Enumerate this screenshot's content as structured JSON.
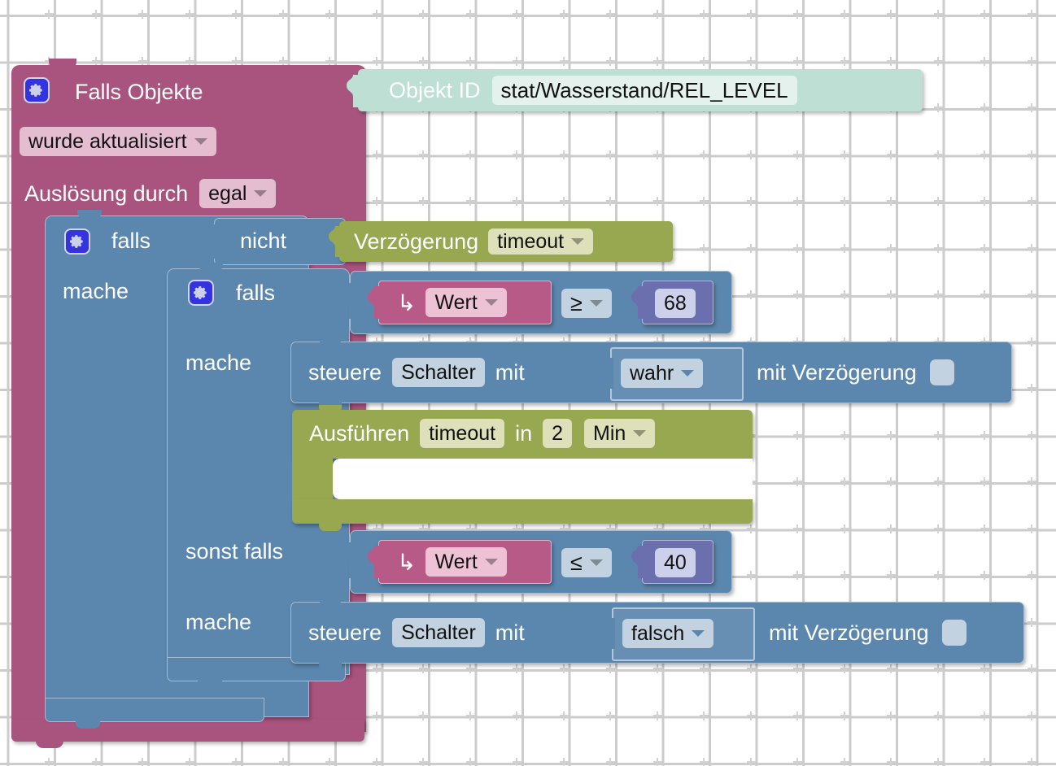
{
  "app": {
    "type": "blockly-visual-script",
    "language": "de"
  },
  "palette": {
    "trigger_block": "#a8547e",
    "logic_block": "#5b86ad",
    "timing_block": "#98a851",
    "object_id_block": "#bedfd3",
    "value_block": "#b85a87",
    "number_block": "#6b6fae",
    "mutator_icon": "#3333e0",
    "workspace_bg": "#ffffff",
    "grid_dot": "#d2d2d2"
  },
  "script": {
    "trigger": {
      "title": "Falls Objekte",
      "mutator_icon": "gear-icon",
      "object_id": {
        "label": "Objekt ID",
        "value": "stat/Wasserstand/REL_LEVEL"
      },
      "condition_dropdown": "wurde aktualisiert",
      "source_label": "Auslösung durch",
      "source_dropdown": "egal"
    },
    "outer_if": {
      "mutator_icon": "gear-icon",
      "if_label": "falls",
      "not_label": "nicht",
      "delay_block": {
        "label": "Verzögerung",
        "dropdown": "timeout"
      },
      "do_label": "mache"
    },
    "inner_if": {
      "mutator_icon": "gear-icon",
      "if_label": "falls",
      "condition": {
        "value_icon": "arrow-return-icon",
        "value_dropdown": "Wert",
        "operator": "≥",
        "number": "68"
      },
      "do_label": "mache",
      "do_statements": [
        {
          "kind": "control",
          "verb": "steuere",
          "target": "Schalter",
          "with_label": "mit",
          "value_dropdown": "wahr",
          "delay_label": "mit Verzögerung",
          "delay_checkbox": false
        },
        {
          "kind": "timeout",
          "verb": "Ausführen",
          "name": "timeout",
          "in_label": "in",
          "amount": "2",
          "unit_dropdown": "Min",
          "body": []
        }
      ],
      "else_if_label": "sonst falls",
      "else_condition": {
        "value_icon": "arrow-return-icon",
        "value_dropdown": "Wert",
        "operator": "≤",
        "number": "40"
      },
      "else_do_label": "mache",
      "else_statements": [
        {
          "kind": "control",
          "verb": "steuere",
          "target": "Schalter",
          "with_label": "mit",
          "value_dropdown": "falsch",
          "delay_label": "mit Verzögerung",
          "delay_checkbox": false
        }
      ]
    }
  }
}
